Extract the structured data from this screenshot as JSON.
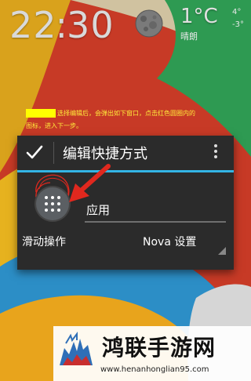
{
  "clock": {
    "hours": "22",
    "colon": ":",
    "minutes": "30"
  },
  "weather": {
    "temperature": "1°C",
    "description": "晴朗",
    "high": "4°",
    "low": "-3°"
  },
  "annotation": {
    "line1": "选择编辑后，会弹出如下窗口，点击红色圆圈内的",
    "line2": "图标，进入下一步。"
  },
  "dialog": {
    "title": "编辑快捷方式",
    "name_value": "应用",
    "swipe_label": "滑动操作",
    "swipe_value": "Nova 设置"
  },
  "watermark": {
    "title": "鸿联手游网",
    "url": "www.henanhonglian95.com"
  },
  "colors": {
    "accent": "#33b5e5",
    "annotation_text": "#ffeb3b",
    "annotation_highlight": "#ffff00",
    "dialog_bg": "#2b2b2b",
    "red_marker": "#e0281e"
  },
  "icons": [
    "moon-icon",
    "check-icon",
    "overflow-menu-icon",
    "app-drawer-icon",
    "red-arrow-icon",
    "deer-logo-icon"
  ]
}
